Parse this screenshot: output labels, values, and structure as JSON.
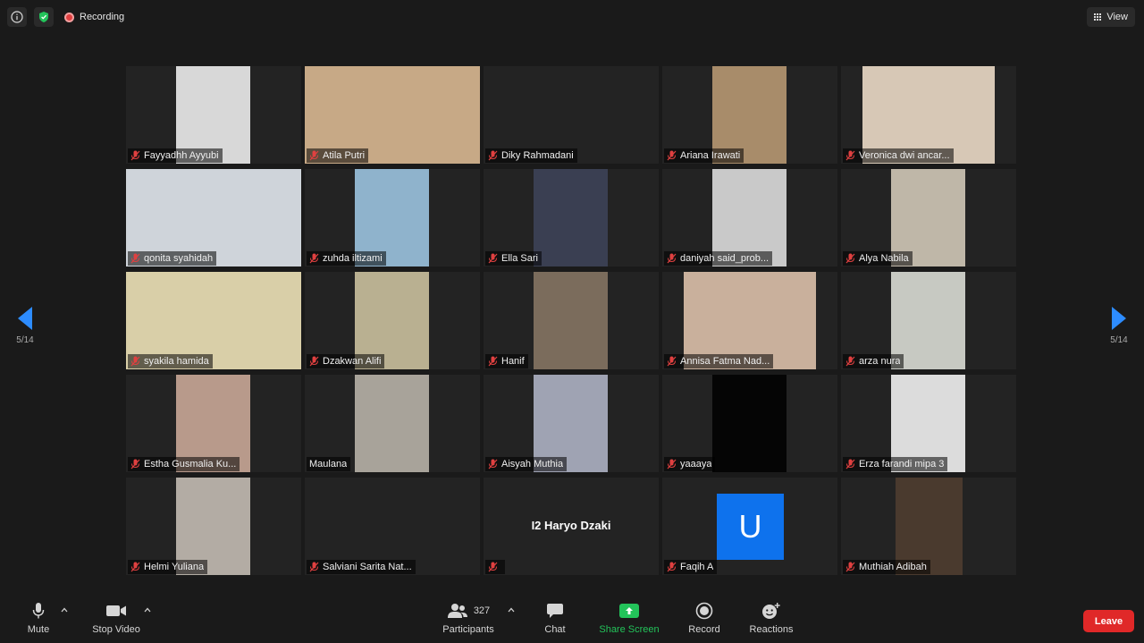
{
  "topbar": {
    "recording_label": "Recording",
    "view_label": "View"
  },
  "navigation": {
    "left_page": "5/14",
    "right_page": "5/14"
  },
  "participants": [
    {
      "name": "Fayyadhh Ayyubi",
      "video_color": "#d8d8d8"
    },
    {
      "name": "Atila Putri",
      "video_color": "#c7a986"
    },
    {
      "name": "Diky Rahmadani",
      "video_color": ""
    },
    {
      "name": "Ariana Irawati",
      "video_color": "#a88c6a"
    },
    {
      "name": "Veronica dwi ancar...",
      "video_color": "#d7c8b6"
    },
    {
      "name": "qonita syahidah",
      "video_color": "#cfd4da"
    },
    {
      "name": "zuhda iltizami",
      "video_color": "#8fb3cc"
    },
    {
      "name": "Ella Sari",
      "video_color": "#3a3f52"
    },
    {
      "name": "daniyah said_prob...",
      "video_color": "#c9c9c9"
    },
    {
      "name": "Alya Nabila",
      "video_color": "#bfb7a8"
    },
    {
      "name": "syakila hamida",
      "video_color": "#d9cfa8"
    },
    {
      "name": "Dzakwan Alifi",
      "video_color": "#b9b091"
    },
    {
      "name": "Hanif",
      "video_color": "#7b6c5c"
    },
    {
      "name": "Annisa Fatma Nad...",
      "video_color": "#c9b09c"
    },
    {
      "name": "arza nura",
      "video_color": "#c7c9c2"
    },
    {
      "name": "Estha Gusmalia Ku...",
      "video_color": "#b89a8b"
    },
    {
      "name": "Maulana",
      "video_color": "#a8a39a"
    },
    {
      "name": "Aisyah Muthia",
      "video_color": "#9fa3b3"
    },
    {
      "name": "yaaaya",
      "video_color": "#050505"
    },
    {
      "name": "Erza farandi mipa 3",
      "video_color": "#dcdcdc"
    },
    {
      "name": "Helmi Yuliana",
      "video_color": "#b3aca4"
    },
    {
      "name": "Salviani Sarita Nat...",
      "video_color": ""
    },
    {
      "name": "",
      "video_color": "",
      "display_name": "I2 Haryo Dzaki"
    },
    {
      "name": "Faqih A",
      "video_color": "",
      "avatar_letter": "U"
    },
    {
      "name": "Muthiah Adibah",
      "video_color": "#4a3a2e"
    }
  ],
  "toolbar": {
    "mute_label": "Mute",
    "stop_video_label": "Stop Video",
    "participants_label": "Participants",
    "participants_count": "327",
    "chat_label": "Chat",
    "share_screen_label": "Share Screen",
    "record_label": "Record",
    "reactions_label": "Reactions",
    "leave_label": "Leave"
  },
  "colors": {
    "background": "#1a1a1a",
    "tile": "#232323",
    "accent_blue": "#2d8cff",
    "share_green": "#23c35a",
    "leave_red": "#e02828",
    "avatar_blue": "#0e72ed"
  }
}
